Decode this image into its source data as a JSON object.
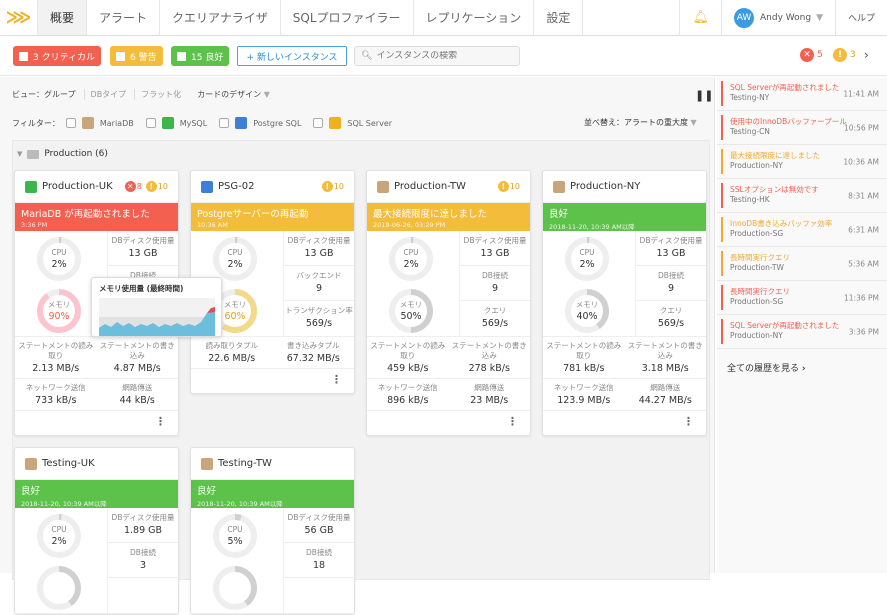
{
  "nav": {
    "logo": "W",
    "tabs": [
      "概要",
      "アラート",
      "クエリアナライザ",
      "SQLプロファイラー",
      "レプリケーション",
      "設定"
    ],
    "active_tab": 0,
    "user_initials": "AW",
    "user_name": "Andy Wong",
    "help": "ヘルプ"
  },
  "toolbar": {
    "critical": "3 クリティカル",
    "warning": "6 警告",
    "good": "15 良好",
    "new_instance": "+ 新しいインスタンス",
    "search_placeholder": "インスタンスの検索",
    "error_count": "5",
    "warn_count": "3"
  },
  "colors": {
    "critical": "#f4604f",
    "warning": "#f3bc3b",
    "good": "#5dc24a",
    "accent": "#2a8ad2"
  },
  "view": {
    "label": "ビュー：",
    "options": [
      "グループ",
      "DBタイプ",
      "フラット化"
    ],
    "card_design": "カードのデザイン",
    "pause_icon": "pause-icon"
  },
  "filter": {
    "label": "フィルター：",
    "items": [
      "MariaDB",
      "MySQL",
      "Postgre SQL",
      "SQL Server"
    ],
    "sort": "並べ替え：アラートの重大度"
  },
  "group": {
    "title": "Production (6)"
  },
  "tooltip": {
    "title": "メモリ使用量 (最終時間)"
  },
  "cards": [
    {
      "name": "Production-UK",
      "db": "mysql",
      "errors": "8",
      "warnings": "10",
      "status": "critical",
      "banner": "MariaDB が再起動されました",
      "time": "3:36 PM",
      "cpu": {
        "label": "CPU",
        "value": "2%",
        "pct": 2
      },
      "mem": {
        "label": "メモリ",
        "value": "90%",
        "pct": 90
      },
      "right": [
        {
          "label": "DBディスク使用量",
          "value": "13 GB"
        },
        {
          "label": "DB接続",
          "value": ""
        },
        {
          "label": "",
          "value": ""
        }
      ],
      "rows": [
        [
          {
            "label": "ステートメントの読み取り",
            "value": "2.13 MB/s"
          },
          {
            "label": "ステートメントの書き込み",
            "value": "4.87 MB/s"
          }
        ],
        [
          {
            "label": "ネットワーク送信",
            "value": "733 kB/s"
          },
          {
            "label": "網路傳送",
            "value": "44 kB/s"
          }
        ]
      ]
    },
    {
      "name": "PSG-02",
      "db": "postgres",
      "warnings": "10",
      "status": "warning",
      "banner": "Postgreサーバーの再起動",
      "time": "10:36 AM",
      "cpu": {
        "label": "CPU",
        "value": "2%",
        "pct": 2
      },
      "mem": {
        "label": "メモリ",
        "value": "60%",
        "pct": 60
      },
      "right": [
        {
          "label": "DBディスク使用量",
          "value": "13 GB"
        },
        {
          "label": "バックエンド",
          "value": "9"
        },
        {
          "label": "トランザクション率",
          "value": "569/s"
        }
      ],
      "rows": [
        [
          {
            "label": "読み取りタプル",
            "value": "22.6 MB/s"
          },
          {
            "label": "書き込みタプル",
            "value": "67.32 MB/s"
          }
        ]
      ]
    },
    {
      "name": "Production-TW",
      "db": "mariadb",
      "warnings": "10",
      "status": "warning",
      "banner": "最大接続限度に達しました",
      "time": "2019-06-26, 03:29 PM",
      "cpu": {
        "label": "CPU",
        "value": "2%",
        "pct": 2
      },
      "mem": {
        "label": "メモリ",
        "value": "50%",
        "pct": 50
      },
      "right": [
        {
          "label": "DBディスク使用量",
          "value": "13 GB"
        },
        {
          "label": "DB接続",
          "value": "9"
        },
        {
          "label": "クエリ",
          "value": "569/s"
        }
      ],
      "rows": [
        [
          {
            "label": "ステートメントの読み取り",
            "value": "459 kB/s"
          },
          {
            "label": "ステートメントの書き込み",
            "value": "278 kB/s"
          }
        ],
        [
          {
            "label": "ネットワーク送信",
            "value": "896 kB/s"
          },
          {
            "label": "網路傳送",
            "value": "23 MB/s"
          }
        ]
      ]
    },
    {
      "name": "Production-NY",
      "db": "mariadb",
      "status": "good",
      "banner": "良好",
      "time": "2018-11-20, 10:39 AM以降",
      "cpu": {
        "label": "CPU",
        "value": "2%",
        "pct": 2
      },
      "mem": {
        "label": "メモリ",
        "value": "40%",
        "pct": 40
      },
      "right": [
        {
          "label": "DBディスク使用量",
          "value": "13 GB"
        },
        {
          "label": "DB接続",
          "value": "9"
        },
        {
          "label": "クエリ",
          "value": "569/s"
        }
      ],
      "rows": [
        [
          {
            "label": "ステートメントの読み取り",
            "value": "781 kB/s"
          },
          {
            "label": "ステートメントの書き込み",
            "value": "3.18 MB/s"
          }
        ],
        [
          {
            "label": "ネットワーク送信",
            "value": "123.9 MB/s"
          },
          {
            "label": "網路傳送",
            "value": "44.27 MB/s"
          }
        ]
      ]
    },
    {
      "name": "Testing-UK",
      "db": "mariadb",
      "status": "good",
      "banner": "良好",
      "time": "2018-11-20, 10:39 AM以降",
      "cpu": {
        "label": "CPU",
        "value": "2%",
        "pct": 2
      },
      "mem": {
        "label": "",
        "value": "",
        "pct": 40
      },
      "right": [
        {
          "label": "DBディスク使用量",
          "value": "1.89 GB"
        },
        {
          "label": "DB接続",
          "value": "3"
        },
        {
          "label": "",
          "value": ""
        }
      ],
      "rows": []
    },
    {
      "name": "Testing-TW",
      "db": "mariadb",
      "status": "good",
      "banner": "良好",
      "time": "2018-11-20, 10:39 AM以降",
      "cpu": {
        "label": "CPU",
        "value": "5%",
        "pct": 5
      },
      "mem": {
        "label": "",
        "value": "",
        "pct": 40
      },
      "right": [
        {
          "label": "DBディスク使用量",
          "value": "56 GB"
        },
        {
          "label": "DB接続",
          "value": "18"
        },
        {
          "label": "",
          "value": ""
        }
      ],
      "rows": []
    }
  ],
  "alerts": [
    {
      "title": "SQL Serverが再起動されました",
      "instance": "Testing-NY",
      "time": "11:41 AM",
      "level": "critical"
    },
    {
      "title": "使用中のInnoDBバッファープール",
      "instance": "Testing-CN",
      "time": "10:56 PM",
      "level": "critical"
    },
    {
      "title": "最大接続限度に達しました",
      "instance": "Production-NY",
      "time": "10:36 AM",
      "level": "warning"
    },
    {
      "title": "SSLオプションは無効です",
      "instance": "Testing-HK",
      "time": "8:31 AM",
      "level": "critical"
    },
    {
      "title": "InnoDB書き込みバッファ効率",
      "instance": "Production-SG",
      "time": "6:31 AM",
      "level": "warning"
    },
    {
      "title": "長時間実行クエリ",
      "instance": "Production-TW",
      "time": "5:36 AM",
      "level": "warning"
    },
    {
      "title": "長時間実行クエリ",
      "instance": "Production-SG",
      "time": "11:36 PM",
      "level": "critical"
    },
    {
      "title": "SQL Serverが再起動されました",
      "instance": "Production-NY",
      "time": "3:36 PM",
      "level": "critical"
    }
  ],
  "view_all": "全ての履歴を見る"
}
